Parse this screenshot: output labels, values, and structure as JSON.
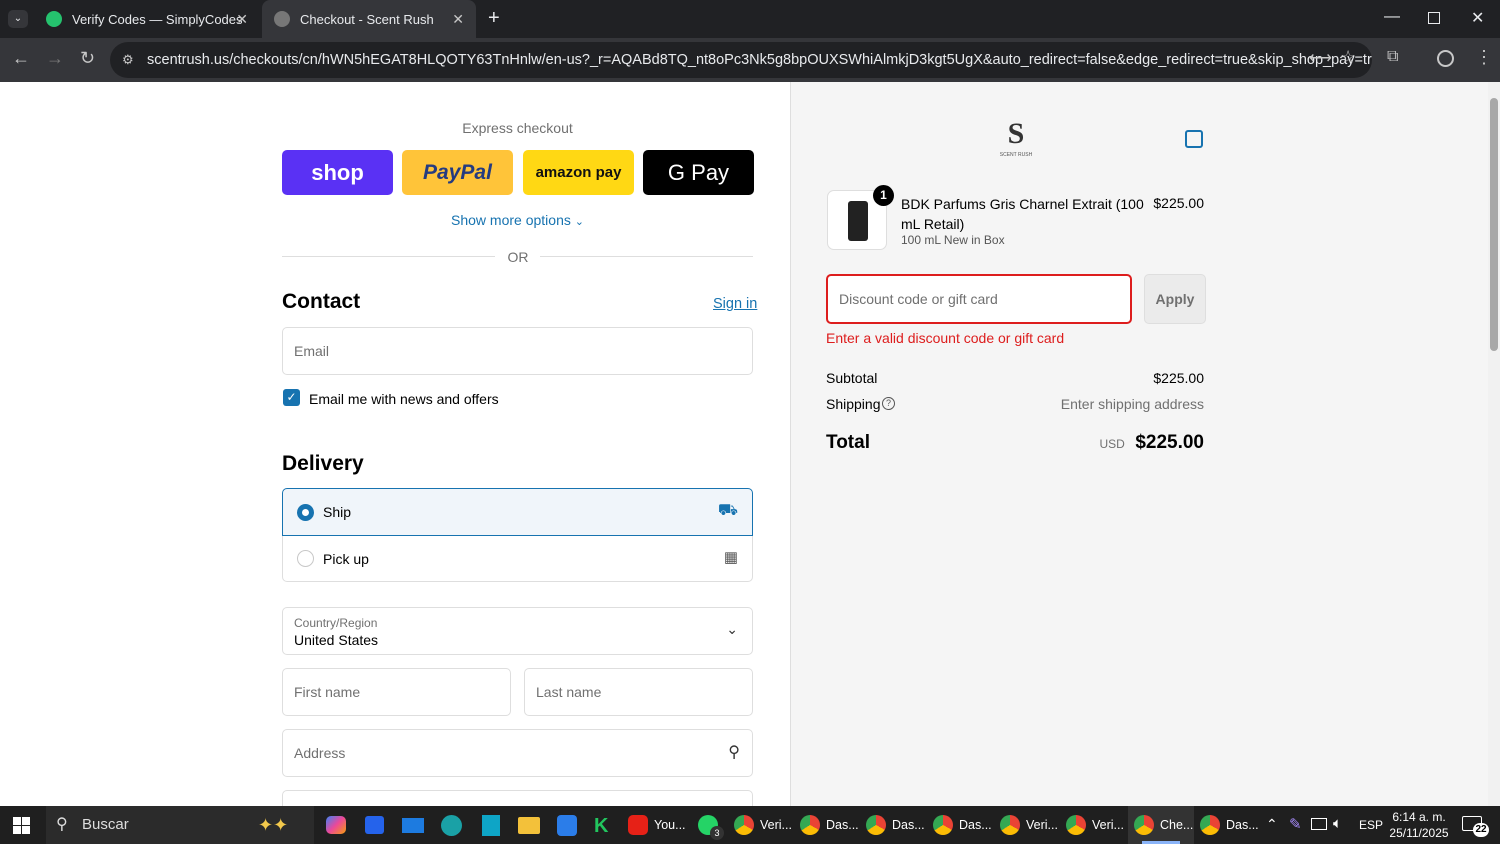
{
  "browser": {
    "tabs": [
      {
        "title": "Verify Codes — SimplyCodes"
      },
      {
        "title": "Checkout - Scent Rush"
      }
    ],
    "url": "scentrush.us/checkouts/cn/hWN5hEGAT8HLQOTY63TnHnlw/en-us?_r=AQABd8TQ_nt8oPc3Nk5g8bpOUXSWhiAlmkjD3kgt5UgX&auto_redirect=false&edge_redirect=true&skip_shop_pay=true"
  },
  "checkout": {
    "express_label": "Express checkout",
    "express_buttons": [
      "shop",
      "PayPal",
      "amazon pay",
      "G Pay"
    ],
    "show_more": "Show more options",
    "or": "OR",
    "contact": {
      "heading": "Contact",
      "sign_in": "Sign in",
      "email_placeholder": "Email",
      "newsletter": "Email me with news and offers",
      "newsletter_checked": true
    },
    "delivery": {
      "heading": "Delivery",
      "options": [
        "Ship",
        "Pick up"
      ],
      "selected": "Ship",
      "country_label": "Country/Region",
      "country_value": "United States",
      "first_name": "First name",
      "last_name": "Last name",
      "address": "Address"
    }
  },
  "summary": {
    "logo_text": "SCENT RUSH",
    "item": {
      "qty": "1",
      "name": "BDK Parfums Gris Charnel Extrait (100 mL Retail)",
      "variant": "100 mL New in Box",
      "price": "$225.00"
    },
    "discount": {
      "placeholder": "Discount code or gift card",
      "apply": "Apply",
      "error": "Enter a valid discount code or gift card"
    },
    "subtotal_label": "Subtotal",
    "subtotal": "$225.00",
    "shipping_label": "Shipping",
    "shipping": "Enter shipping address",
    "total_label": "Total",
    "currency": "USD",
    "total": "$225.00"
  },
  "taskbar": {
    "search": "Buscar",
    "items": [
      "You...",
      "Veri...",
      "Das...",
      "Das...",
      "Das...",
      "Veri...",
      "Veri...",
      "Che...",
      "Das..."
    ],
    "lang": "ESP",
    "time": "6:14 a. m.",
    "date": "25/11/2025",
    "notifications": "22",
    "whatsapp_badge": "3"
  },
  "colors": {
    "shop": "#5a31f4",
    "paypal": "#ffc439",
    "amazon": "#ffd814",
    "gpay": "#000000",
    "link": "#1773b0",
    "error": "#dd1d1d"
  }
}
